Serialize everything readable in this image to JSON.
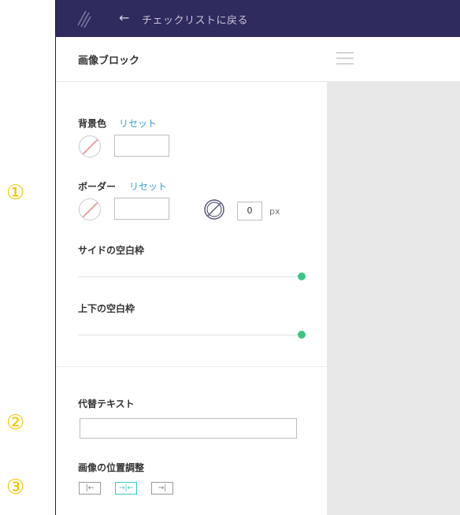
{
  "markers": {
    "m1": "①",
    "m2": "②",
    "m3": "③"
  },
  "topbar": {
    "back_arrow": "←",
    "back_label": "チェックリストに戻る"
  },
  "panel": {
    "title": "画像ブロック"
  },
  "background": {
    "label": "背景色",
    "reset": "リセット",
    "color_value": ""
  },
  "border": {
    "label": "ボーダー",
    "reset": "リセット",
    "color_value": "",
    "width_value": "0",
    "width_unit": "px"
  },
  "side_padding": {
    "label": "サイドの空白枠",
    "value_fraction": 1.0
  },
  "vertical_padding": {
    "label": "上下の空白枠",
    "value_fraction": 1.0
  },
  "alt_text": {
    "label": "代替テキスト",
    "value": ""
  },
  "alignment": {
    "label": "画像の位置調整",
    "options": [
      {
        "glyph": "|←",
        "name": "left",
        "active": false
      },
      {
        "glyph": "→|←",
        "name": "center",
        "active": true
      },
      {
        "glyph": "→|",
        "name": "right",
        "active": false
      }
    ]
  },
  "colors": {
    "topbar": "#2f2b5e",
    "accent_green": "#3ec585",
    "link_blue": "#3aa0d8",
    "marker_yellow": "#f2c200"
  }
}
